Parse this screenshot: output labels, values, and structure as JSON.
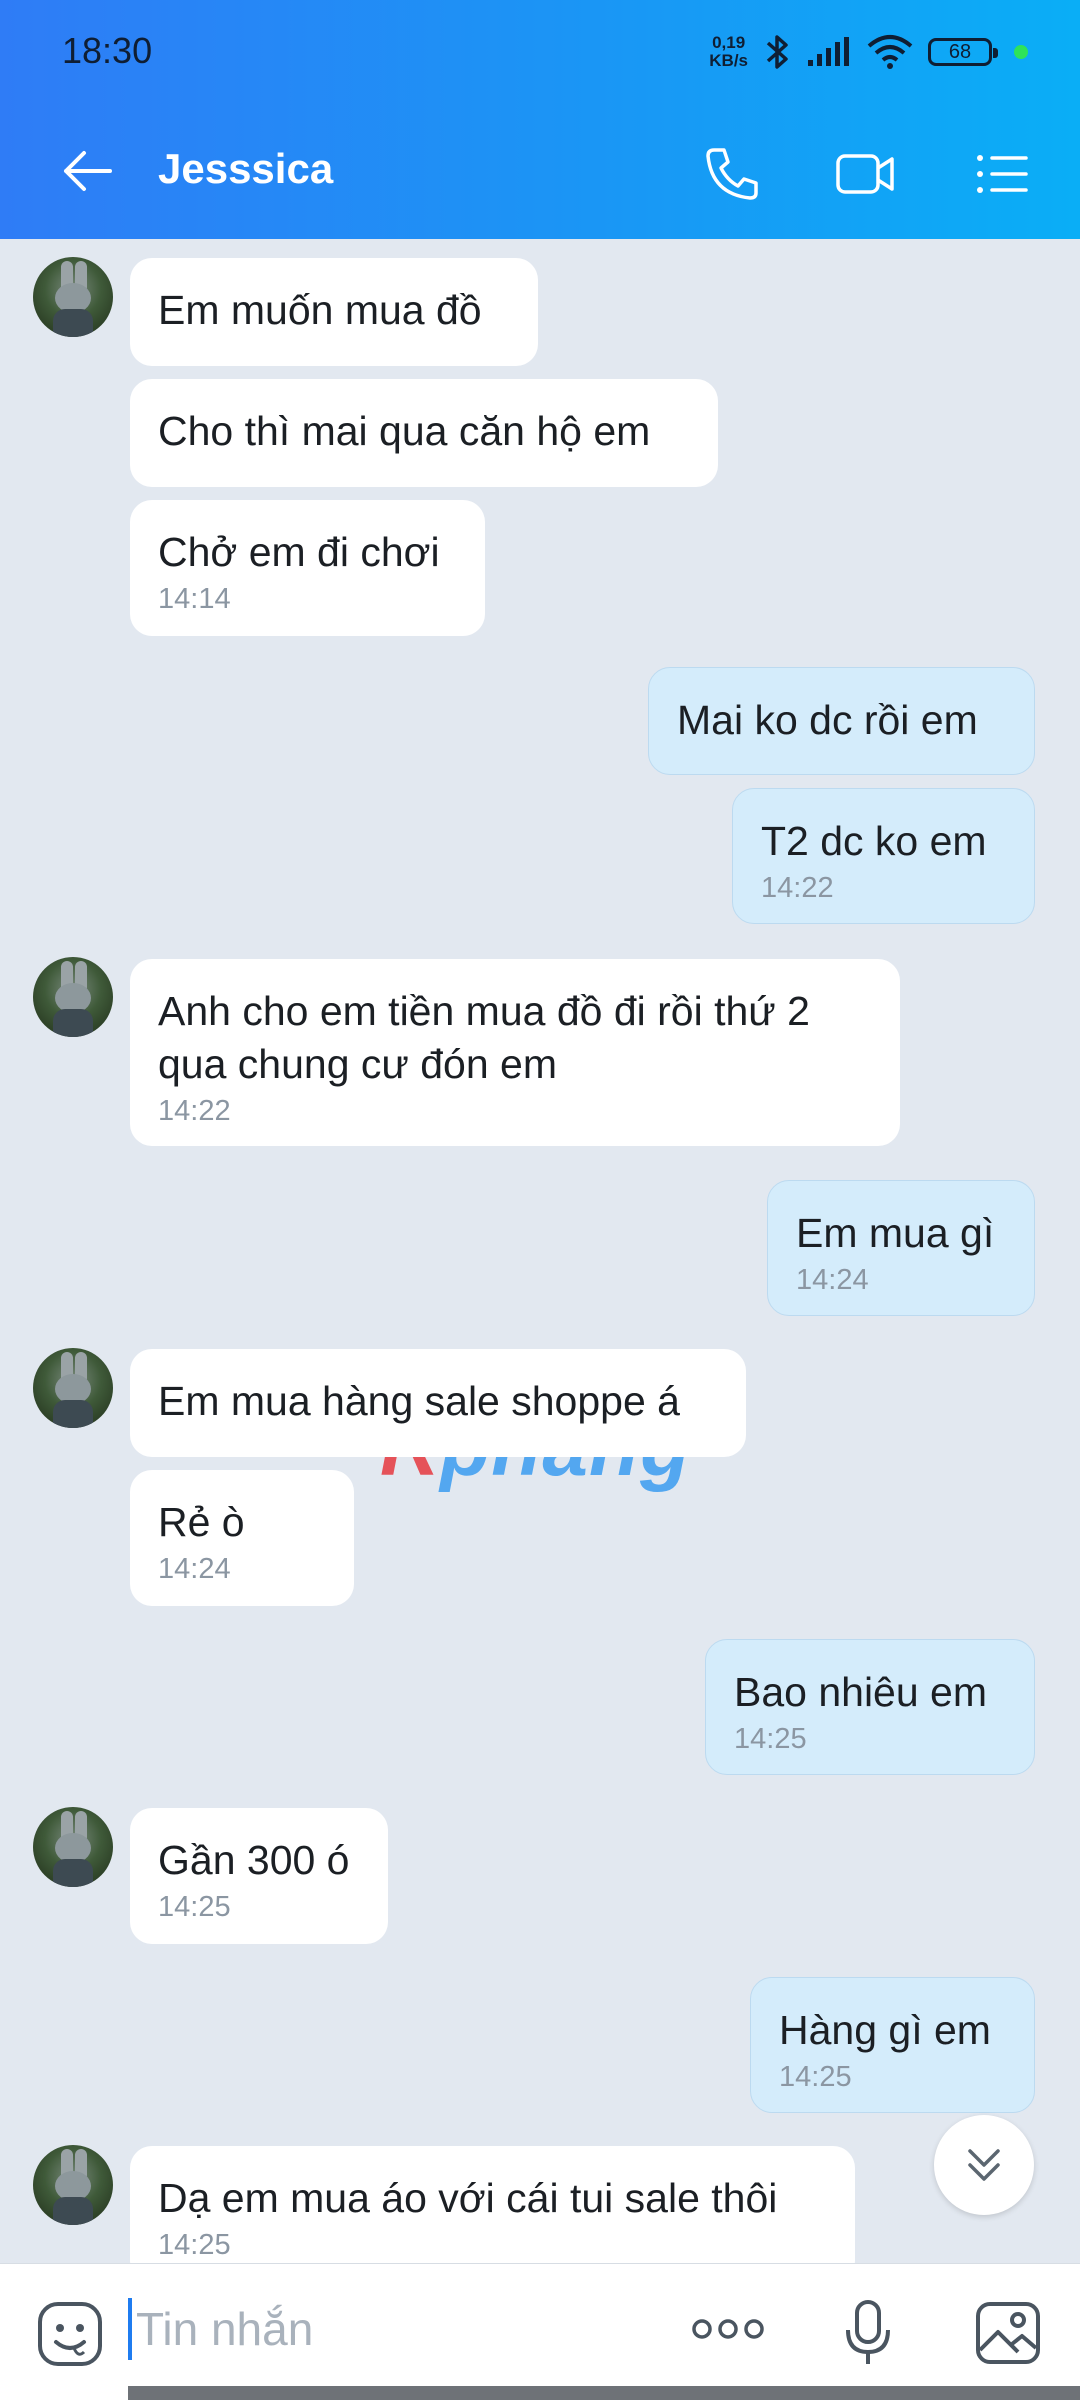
{
  "status_bar": {
    "time": "18:30",
    "speed_value": "0,19",
    "speed_unit": "KB/s",
    "battery": "68"
  },
  "header": {
    "title": "Jesssica"
  },
  "icons": {
    "back": "arrow-left-icon",
    "call": "phone-icon",
    "video": "video-camera-icon",
    "menu": "list-menu-icon",
    "sticker": "sticker-face-icon",
    "more": "more-dots-icon",
    "mic": "microphone-icon",
    "gallery": "image-icon",
    "scroll": "chevron-double-down-icon"
  },
  "messages": [
    {
      "text": "Em muốn mua đồ",
      "time": ""
    },
    {
      "text": "Cho thì mai qua căn hộ em",
      "time": ""
    },
    {
      "text": "Chở em đi chơi",
      "time": "14:14"
    },
    {
      "text": "Mai ko dc rồi em",
      "time": ""
    },
    {
      "text": "T2 dc ko em",
      "time": "14:22"
    },
    {
      "text": "Anh cho em tiền mua đồ đi rồi thứ 2\nqua chung cư đón em",
      "time": "14:22"
    },
    {
      "text": "Em mua gì",
      "time": "14:24"
    },
    {
      "text": "Em mua hàng sale shoppe á",
      "time": ""
    },
    {
      "text": "Rẻ ò",
      "time": "14:24"
    },
    {
      "text": "Bao nhiêu em",
      "time": "14:25"
    },
    {
      "text": "Gần 300 ó",
      "time": "14:25"
    },
    {
      "text": "Hàng gì em",
      "time": "14:25"
    },
    {
      "text": "Dạ em mua áo với cái tui sale thôi",
      "time": "14:25"
    }
  ],
  "watermark": {
    "part1": "R",
    "part2": "phang"
  },
  "input": {
    "placeholder": "Tin nhắn"
  },
  "colors": {
    "header_start": "#2f7cf6",
    "header_end": "#0aaef6",
    "outgoing_bubble": "#d4ecfb",
    "incoming_bubble": "#ffffff",
    "chat_bg": "#e2e8f0"
  }
}
